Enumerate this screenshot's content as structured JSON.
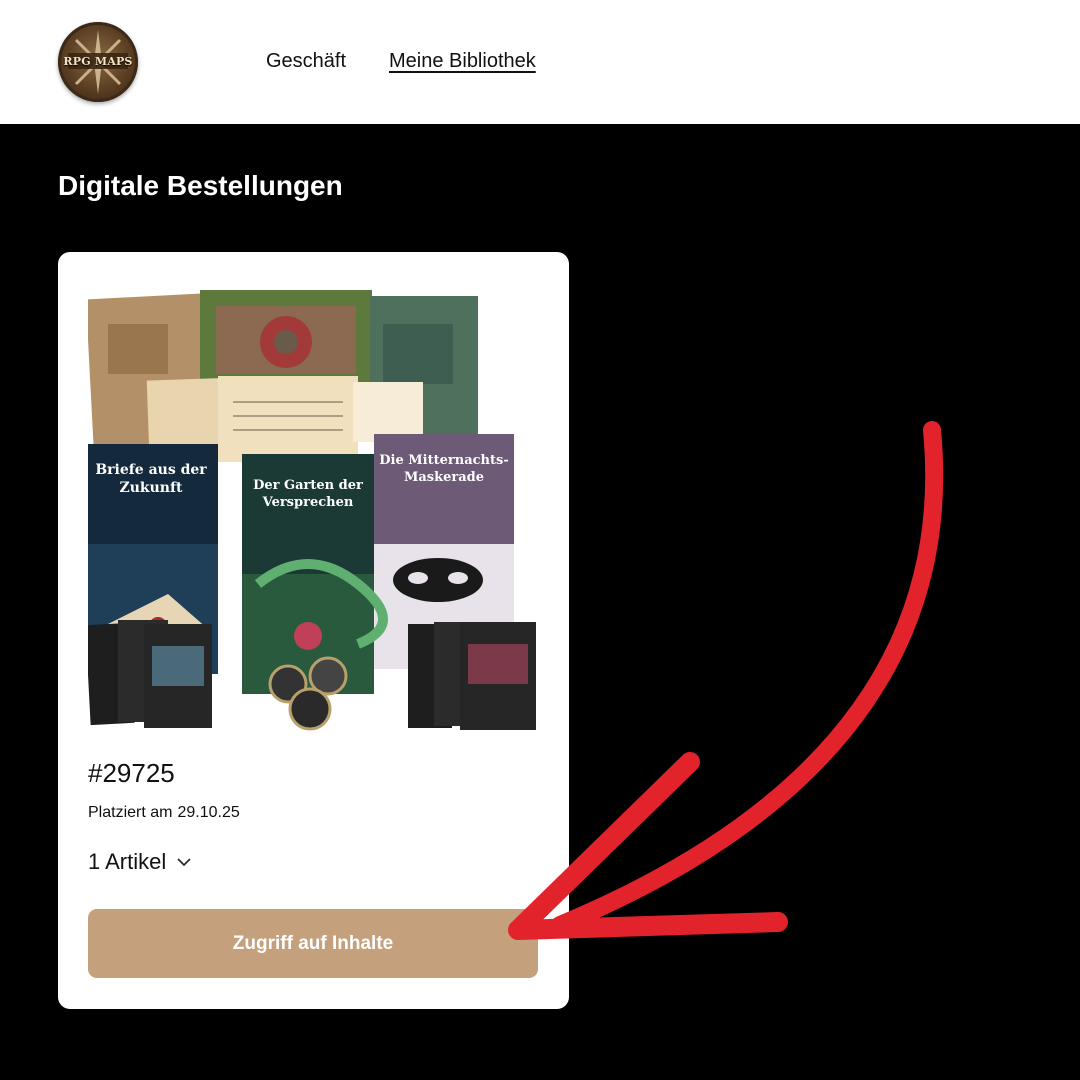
{
  "header": {
    "logo_text": "RPG MAPS",
    "nav": [
      {
        "label": "Geschäft"
      },
      {
        "label": "Meine Bibliothek"
      }
    ]
  },
  "page": {
    "title": "Digitale Bestellungen"
  },
  "order": {
    "number": "#29725",
    "placed_label": "Platziert am",
    "placed_date": "29.10.25",
    "items_label": "1 Artikel",
    "access_button_label": "Zugriff auf Inhalte"
  },
  "product_image": {
    "books": [
      {
        "title_line1": "Briefe aus der",
        "title_line2": "Zukunft"
      },
      {
        "title_line1": "Der Garten der",
        "title_line2": "Versprechen"
      },
      {
        "title_line1": "Die Mitternachts-",
        "title_line2": "Maskerade"
      }
    ]
  },
  "colors": {
    "page_background": "#000000",
    "header_background": "#ffffff",
    "button_background": "#c4a07c",
    "annotation_arrow": "#e3232c"
  },
  "icons": {
    "logo": "rpg-maps-logo-icon",
    "items_toggle": "chevron-down-icon",
    "annotation": "red-arrow-icon"
  }
}
